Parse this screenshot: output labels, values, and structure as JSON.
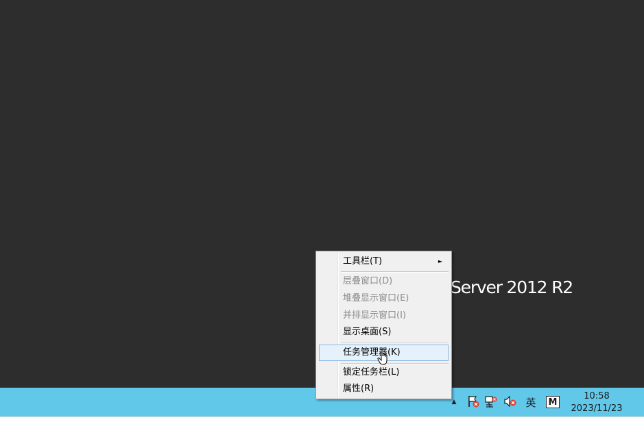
{
  "desktop": {
    "watermark_text": "Server 2012 R2"
  },
  "context_menu": {
    "items": [
      {
        "label": "工具栏(T)",
        "disabled": false,
        "has_submenu": true
      },
      {
        "label": "层叠窗口(D)",
        "disabled": true
      },
      {
        "label": "堆叠显示窗口(E)",
        "disabled": true
      },
      {
        "label": "并排显示窗口(I)",
        "disabled": true
      },
      {
        "label": "显示桌面(S)",
        "disabled": false
      },
      {
        "label": "任务管理器(K)",
        "disabled": false,
        "highlighted": true
      },
      {
        "label": "锁定任务栏(L)",
        "disabled": false
      },
      {
        "label": "属性(R)",
        "disabled": false
      }
    ]
  },
  "taskbar": {
    "background_color": "#62c8ea",
    "tray": {
      "overflow_icon": "chevron-up-icon",
      "action_center_icon": "flag-error-icon",
      "network_icon": "network-error-icon",
      "volume_icon": "volume-muted-icon",
      "ime_language": "英",
      "ime_mode": "M",
      "clock": {
        "time": "10:58",
        "date": "2023/11/23"
      }
    }
  }
}
